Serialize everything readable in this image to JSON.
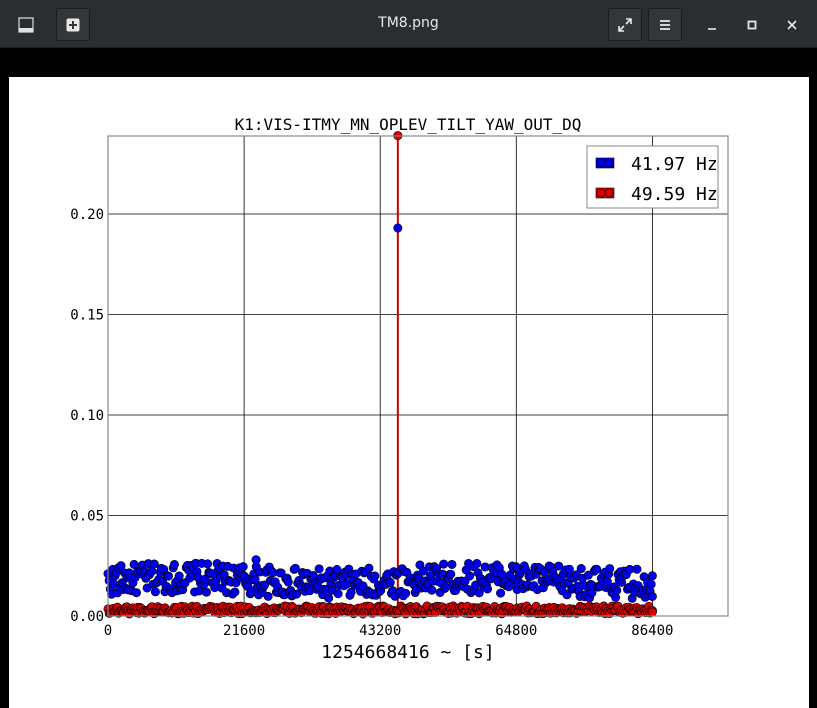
{
  "window": {
    "title": "TM8.png"
  },
  "icons": {
    "minimize_left": "bar-icon",
    "new_tab": "plus-square-icon",
    "fullscreen": "expand-arrows-icon",
    "menu": "hamburger-menu-icon",
    "minimize": "minimize-icon",
    "maximize": "maximize-icon",
    "close": "close-icon"
  },
  "colors": {
    "blue_series": "#0000ee",
    "red_series": "#dd0000",
    "line": "#cc0000"
  },
  "chart_data": {
    "type": "scatter",
    "title": "K1:VIS-ITMY_MN_OPLEV_TILT_YAW_OUT_DQ",
    "xlabel": "1254668416 ~ [s]",
    "ylabel": "",
    "xlim": [
      0,
      86400
    ],
    "ylim": [
      0,
      0.2388
    ],
    "x_ticks": [
      "0",
      "21600",
      "43200",
      "64800",
      "86400"
    ],
    "x_tick_values": [
      0,
      21600,
      43200,
      64800,
      86400
    ],
    "y_ticks": [
      "0.00",
      "0.05",
      "0.10",
      "0.15",
      "0.20"
    ],
    "y_tick_values": [
      0,
      0.05,
      0.1,
      0.15,
      0.2
    ],
    "grid": true,
    "legend": "top-right",
    "series": [
      {
        "name": "41.97 Hz",
        "color": "#0000ee",
        "x_range": [
          0,
          86400
        ],
        "typical_range": [
          0.01,
          0.025
        ],
        "points": [
          [
            46000,
            0.193
          ],
          [
            23500,
            0.028
          ],
          [
            86400,
            0.02
          ]
        ]
      },
      {
        "name": "49.59 Hz",
        "color": "#dd0000",
        "x_range": [
          0,
          86400
        ],
        "typical_range": [
          0.001,
          0.005
        ],
        "points": [
          [
            46000,
            0.239
          ],
          [
            86400,
            0.002
          ]
        ],
        "vertical_line": {
          "x": 46000,
          "from": 0,
          "to": 0.239
        }
      }
    ]
  }
}
